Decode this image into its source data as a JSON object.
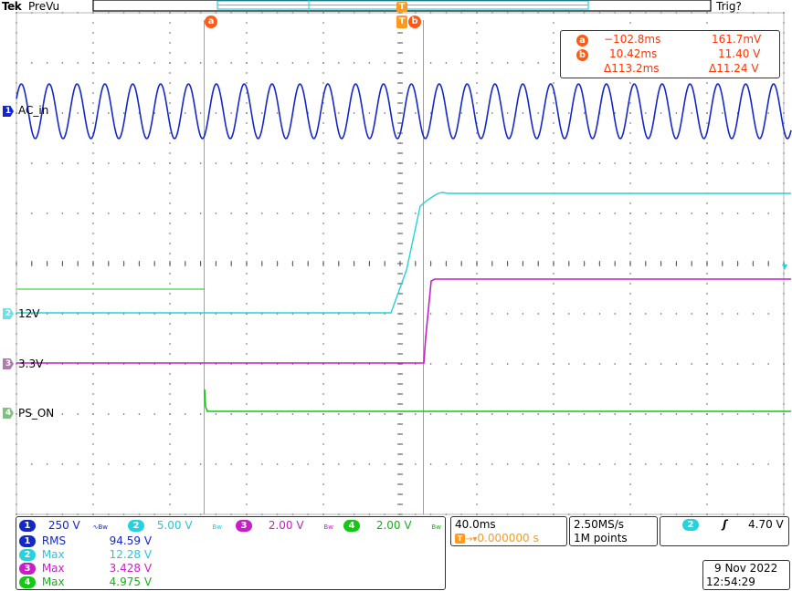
{
  "header": {
    "logo": "Tek",
    "mode": "PreVu",
    "trigger_status": "Trig?"
  },
  "colors": {
    "ch1": "#1428c8",
    "ch2": "#26d2dc",
    "ch3": "#c81ec8",
    "ch4": "#14c814",
    "cursor": "#ff5a14",
    "trigger": "#ff9a1f"
  },
  "cursors": {
    "a_label": "a",
    "b_label": "b",
    "trigger_label": "T",
    "a_time": "−102.8ms",
    "a_value": "161.7mV",
    "b_time": "10.42ms",
    "b_value": "11.40 V",
    "delta_time": "Δ113.2ms",
    "delta_value": "Δ11.24 V"
  },
  "traces": [
    {
      "number": "1",
      "label": "AC_in"
    },
    {
      "number": "2",
      "label": "12V"
    },
    {
      "number": "3",
      "label": "3.3V"
    },
    {
      "number": "4",
      "label": "PS_ON"
    }
  ],
  "channels": [
    {
      "number": "1",
      "scale": "250 V",
      "coupling_icon": "∿Bw"
    },
    {
      "number": "2",
      "scale": "5.00 V",
      "coupling_icon": "Bw"
    },
    {
      "number": "3",
      "scale": "2.00 V",
      "coupling_icon": "Bw"
    },
    {
      "number": "4",
      "scale": "2.00 V",
      "coupling_icon": "Bw"
    }
  ],
  "measurements": [
    {
      "number": "1",
      "type": "RMS",
      "value": "94.59 V"
    },
    {
      "number": "2",
      "type": "Max",
      "value": "12.28 V"
    },
    {
      "number": "3",
      "type": "Max",
      "value": "3.428 V"
    },
    {
      "number": "4",
      "type": "Max",
      "value": "4.975 V"
    }
  ],
  "timebase": {
    "scale": "40.0ms",
    "trigger_position": "0.000000 s"
  },
  "acquisition": {
    "sample_rate": "2.50MS/s",
    "record_length": "1M points"
  },
  "trigger": {
    "source": "2",
    "slope_icon": "rising-edge",
    "level": "4.70 V"
  },
  "datetime": {
    "date": "9 Nov 2022",
    "time": "12:54:29"
  }
}
